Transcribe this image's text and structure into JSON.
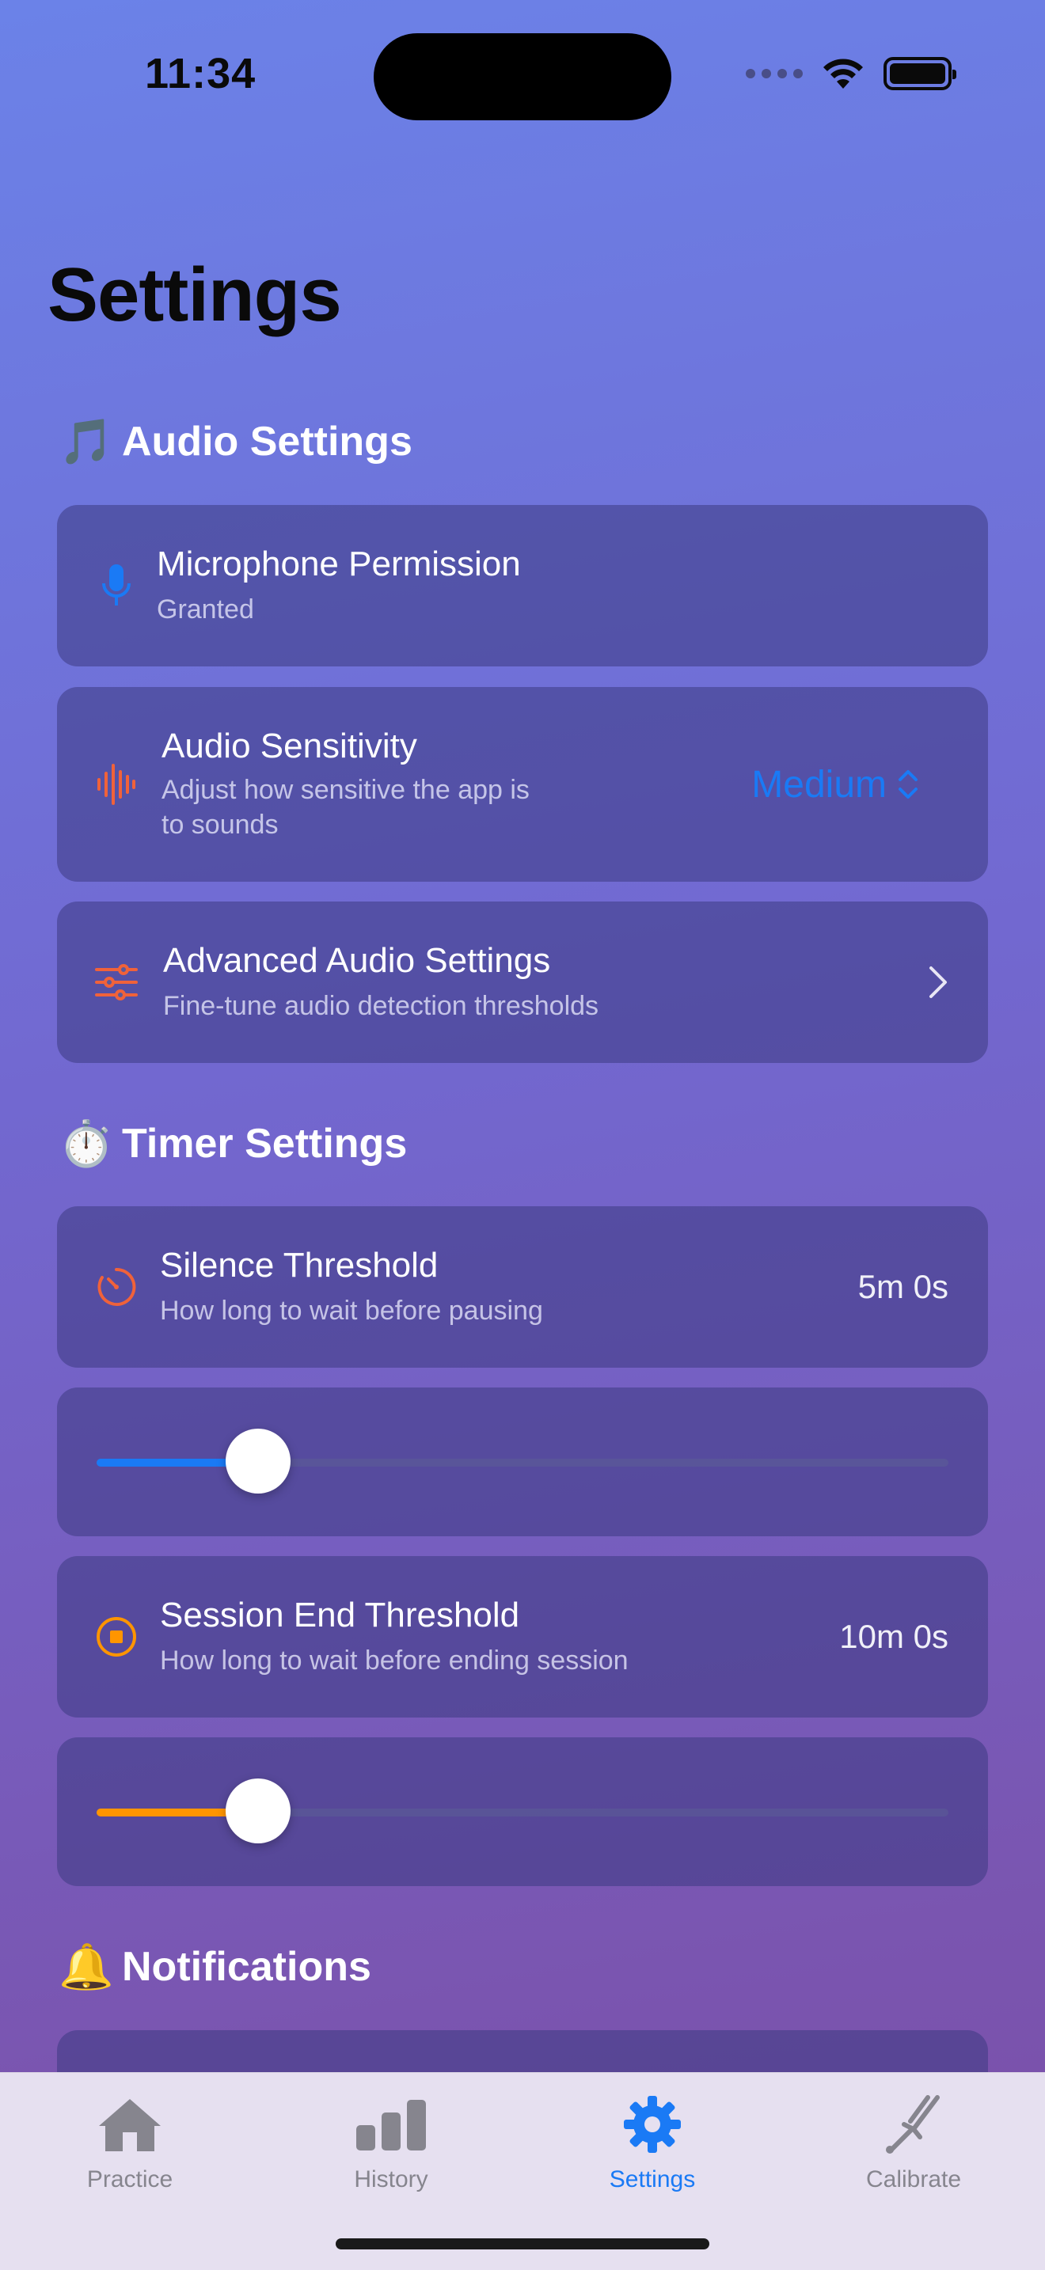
{
  "status_bar": {
    "time": "11:34"
  },
  "page": {
    "title": "Settings"
  },
  "audio_section": {
    "emoji": "🎵",
    "title": "Audio Settings",
    "microphone": {
      "title": "Microphone Permission",
      "subtitle": "Granted",
      "icon": "mic-icon"
    },
    "sensitivity": {
      "title": "Audio Sensitivity",
      "subtitle_line1": "Adjust how sensitive the app is",
      "subtitle_line2": "to sounds",
      "value": "Medium",
      "icon": "waveform-icon"
    },
    "advanced": {
      "title": "Advanced Audio Settings",
      "subtitle": "Fine-tune audio detection thresholds",
      "icon": "sliders-icon"
    }
  },
  "timer_section": {
    "emoji": "⏱️",
    "title": "Timer Settings",
    "silence": {
      "title": "Silence Threshold",
      "subtitle": "How long to wait before pausing",
      "value": "5m 0s",
      "slider_fraction": 0.19
    },
    "session_end": {
      "title": "Session End Threshold",
      "subtitle": "How long to wait before ending session",
      "value": "10m 0s",
      "slider_fraction": 0.19
    }
  },
  "notifications_section": {
    "emoji": "🔔",
    "title": "Notifications"
  },
  "tab_bar": {
    "items": [
      {
        "label": "Practice",
        "icon": "house-icon",
        "active": false
      },
      {
        "label": "History",
        "icon": "bar-chart-icon",
        "active": false
      },
      {
        "label": "Settings",
        "icon": "gear-icon",
        "active": true
      },
      {
        "label": "Calibrate",
        "icon": "tuning-fork-icon",
        "active": false
      }
    ]
  },
  "colors": {
    "accent": "#1A7AF5",
    "orange": "#FF9500",
    "icon_red": "#F0623A"
  }
}
